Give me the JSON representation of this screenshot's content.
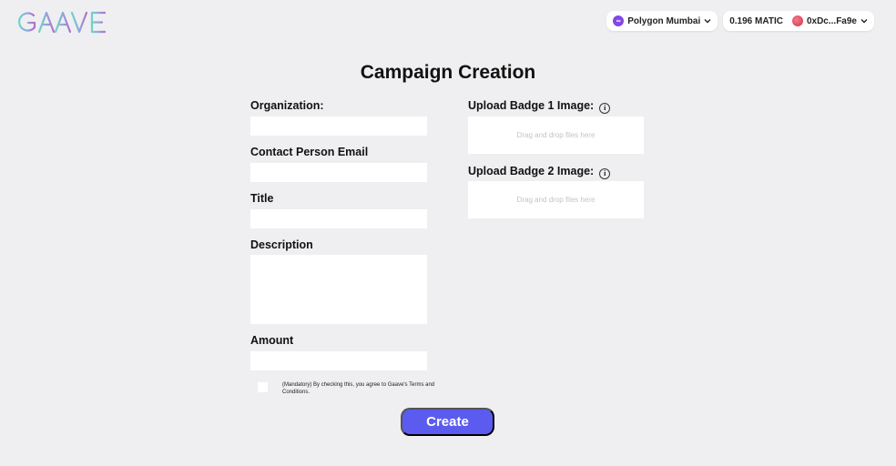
{
  "header": {
    "logo_text": "GAAVE",
    "network": {
      "label": "Polygon Mumbai",
      "icon": "polygon-icon"
    },
    "balance": "0.196 MATIC",
    "account": "0xDc...Fa9e"
  },
  "page": {
    "title": "Campaign Creation"
  },
  "form": {
    "organization": {
      "label": "Organization:",
      "value": ""
    },
    "email": {
      "label": "Contact Person Email",
      "value": ""
    },
    "title": {
      "label": "Title",
      "value": ""
    },
    "description": {
      "label": "Description",
      "value": ""
    },
    "amount": {
      "label": "Amount",
      "value": ""
    },
    "badge1": {
      "label": "Upload Badge 1 Image:",
      "dropzone_text": "Drag and drop files here"
    },
    "badge2": {
      "label": "Upload Badge 2 Image:",
      "dropzone_text": "Drag and drop files here"
    },
    "terms_text": "(Mandatory) By checking this, you agree to Gaave's Terms and Conditions.",
    "terms_checked": false,
    "submit_label": "Create"
  },
  "colors": {
    "background": "#efeff1",
    "accent": "#5b5bf0",
    "polygon": "#8247e5"
  }
}
